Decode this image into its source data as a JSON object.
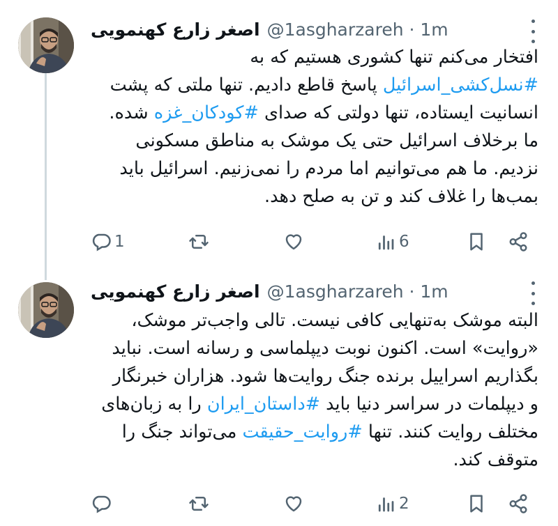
{
  "colors": {
    "text": "#0f1419",
    "secondary": "#536471",
    "link": "#1d9bf0",
    "thread_line": "#cfd9de"
  },
  "tweets": [
    {
      "author_name": "اصغر زارع کهنمویی",
      "handle_time": "@1asgharzareh · 1m",
      "lines": [
        [
          {
            "t": "افتخار می‌کنم تنها کشوری هستیم که به"
          }
        ],
        [
          {
            "t": "#نسل‌کشی_اسرائیل",
            "tag": true
          },
          {
            "t": " پاسخ قاطع دادیم. تنها ملتی که پشت"
          }
        ],
        [
          {
            "t": "انسانیت ایستاده، تنها دولتی که صدای "
          },
          {
            "t": "#کودکان_غزه",
            "tag": true
          },
          {
            "t": " شده."
          }
        ],
        [
          {
            "t": "ما برخلاف اسرائیل حتی یک موشک به مناطق مسکونی"
          }
        ],
        [
          {
            "t": "نزدیم. ما هم می‌توانیم اما مردم را نمی‌زنیم. اسرائیل باید"
          }
        ],
        [
          {
            "t": "بمب‌ها را غلاف کند و تن به صلح دهد."
          }
        ]
      ],
      "reply_count": "1",
      "retweet_count": "",
      "like_count": "",
      "view_count": "6"
    },
    {
      "author_name": "اصغر زارع کهنمویی",
      "handle_time": "@1asgharzareh · 1m",
      "lines": [
        [
          {
            "t": "البته موشک به‌تنهایی کافی نیست. تالی واجب‌تر موشک،"
          }
        ],
        [
          {
            "t": "«روایت» است. اکنون نوبت دیپلماسی و رسانه است. نباید"
          }
        ],
        [
          {
            "t": "بگذاریم اسراییل برنده جنگ روایت‌ها شود. هزاران خبرنگار"
          }
        ],
        [
          {
            "t": "و دیپلمات در سراسر دنیا باید "
          },
          {
            "t": "#داستان_ایران",
            "tag": true
          },
          {
            "t": " را به زبان‌های"
          }
        ],
        [
          {
            "t": "مختلف روایت کنند. تنها "
          },
          {
            "t": "#روایت_حقیقت",
            "tag": true
          },
          {
            "t": " می‌تواند جنگ را"
          }
        ],
        [
          {
            "t": "متوقف کند."
          }
        ]
      ],
      "reply_count": "",
      "retweet_count": "",
      "like_count": "",
      "view_count": "2"
    }
  ],
  "icons": {
    "reply": "reply-icon",
    "retweet": "retweet-icon",
    "like": "heart-icon",
    "views": "views-icon",
    "bookmark": "bookmark-icon",
    "share": "share-icon",
    "more": "more-icon"
  }
}
